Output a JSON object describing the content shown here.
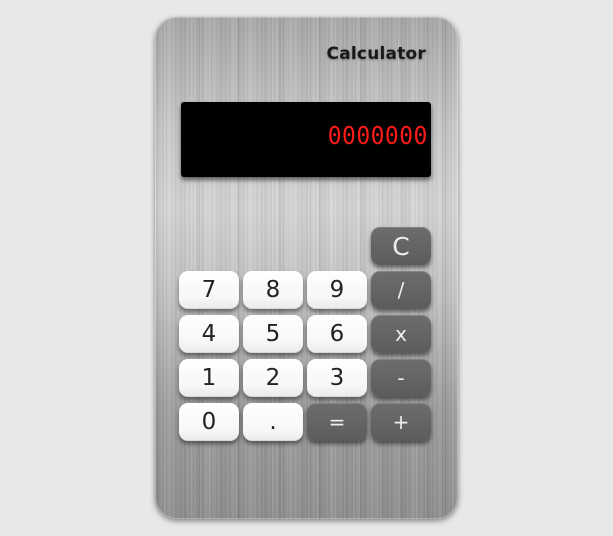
{
  "app": {
    "title": "Calculator"
  },
  "display": {
    "value": "0000000",
    "color": "#ff1a1a"
  },
  "keys": {
    "clear": "C",
    "k7": "7",
    "k8": "8",
    "k9": "9",
    "divide": "/",
    "k4": "4",
    "k5": "5",
    "k6": "6",
    "multiply": "x",
    "k1": "1",
    "k2": "2",
    "k3": "3",
    "subtract": "-",
    "k0": "0",
    "decimal": ".",
    "equals": "=",
    "add": "+"
  },
  "colors": {
    "number_key": "#f7f7f7",
    "operator_key": "#5f5f5f",
    "display_bg": "#000000"
  }
}
